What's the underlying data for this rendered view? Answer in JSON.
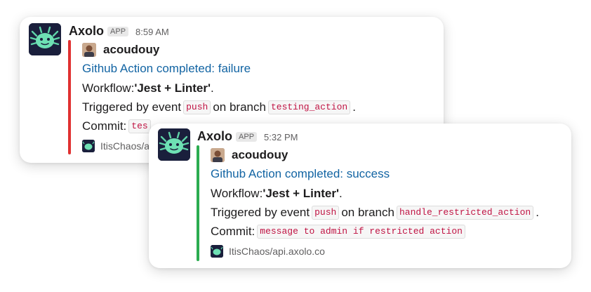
{
  "messages": [
    {
      "app_name": "Axolo",
      "app_badge": "APP",
      "timestamp": "8:59 AM",
      "author": "acoudouy",
      "title": "Github Action completed: failure",
      "workflow_prefix": "Workflow: ",
      "workflow_name": "'Jest + Linter'",
      "workflow_suffix": ".",
      "trigger_prefix": "Triggered by event",
      "event": "push",
      "branch_prefix": "on branch",
      "branch": "testing_action",
      "branch_suffix": ".",
      "commit_prefix": "Commit:",
      "commit_visible": "tes",
      "repo_visible": "ItisChaos/a",
      "status_color": "#e03131"
    },
    {
      "app_name": "Axolo",
      "app_badge": "APP",
      "timestamp": "5:32 PM",
      "author": "acoudouy",
      "title": "Github Action completed: success",
      "workflow_prefix": "Workflow: ",
      "workflow_name": "'Jest + Linter'",
      "workflow_suffix": ".",
      "trigger_prefix": "Triggered by event",
      "event": "push",
      "branch_prefix": "on branch",
      "branch": "handle_restricted_action",
      "branch_suffix": ".",
      "commit_prefix": "Commit:",
      "commit": "message to admin if restricted action",
      "repo": "ItisChaos/api.axolo.co",
      "status_color": "#2bac50"
    }
  ],
  "icons": {
    "app_avatar": "axolotl-logo-icon",
    "author_avatar": "user-photo-icon",
    "repo_logo": "axolotl-logo-icon"
  },
  "colors": {
    "link": "#1264a3",
    "code_text": "#c01343",
    "muted": "#616061"
  }
}
